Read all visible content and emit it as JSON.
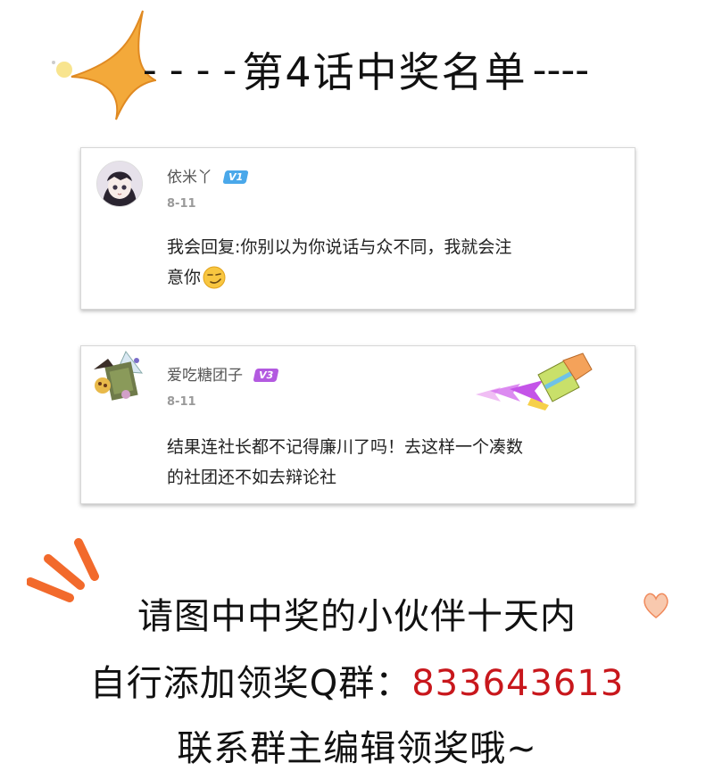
{
  "header": {
    "dashes_left": "- - - -",
    "title": "第4话中奖名单",
    "dashes_right": "----"
  },
  "comments": [
    {
      "username": "依米丫",
      "vip": "V1",
      "vip_color": "#4aa8ea",
      "date": "8-11",
      "text_line1": "我会回复:你别以为你说话与众不同，我就会注",
      "text_line2": "意你",
      "emoji": "smirk-emoji"
    },
    {
      "username": "爱吃糖团子",
      "vip": "V3",
      "vip_color": "#b35ae0",
      "date": "8-11",
      "text_line1": "结果连社长都不记得廉川了吗！去这样一个凑数",
      "text_line2": "的社团还不如去辩论社",
      "decoration": "paintbrush-icon"
    }
  ],
  "notice": {
    "line1": "请图中中奖的小伙伴十天内",
    "line2_prefix": "自行添加领奖Q群：",
    "line2_number": "833643613",
    "line3": "联系群主编辑领奖哦~",
    "accent_color": "#c8171c"
  },
  "colors": {
    "star": "#f3a93a",
    "deco_lines": "#f26a2c",
    "heart": "#f5b08a"
  }
}
